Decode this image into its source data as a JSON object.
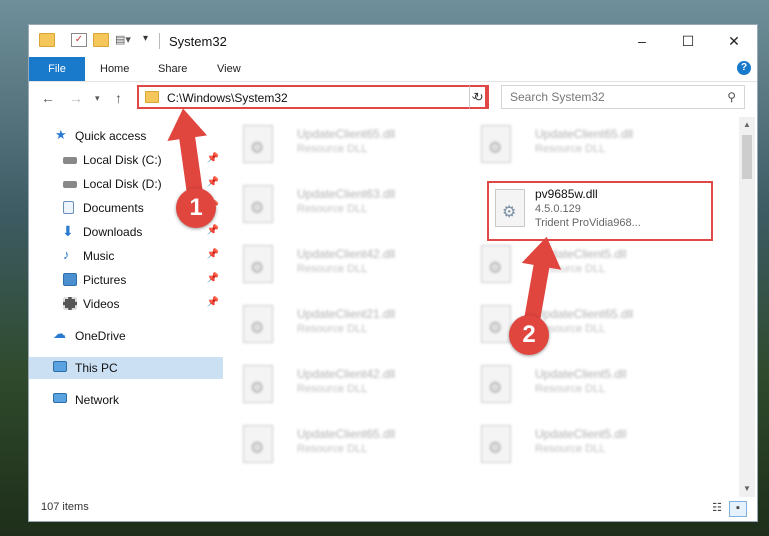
{
  "window": {
    "title": "System32",
    "controls": {
      "minimize": "–",
      "maximize": "☐",
      "close": "✕"
    }
  },
  "ribbon": {
    "tabs": [
      "File",
      "Home",
      "Share",
      "View"
    ],
    "help": "?"
  },
  "nav": {
    "address": "C:\\Windows\\System32",
    "search_placeholder": "Search System32"
  },
  "sidebar": {
    "items": [
      {
        "label": "Quick access",
        "icon": "star-icon",
        "color": "#2b79d0",
        "pinned": false
      },
      {
        "label": "Local Disk (C:)",
        "icon": "drive-icon",
        "color": "#777777",
        "pinned": true
      },
      {
        "label": "Local Disk (D:)",
        "icon": "drive-icon",
        "color": "#777777",
        "pinned": true
      },
      {
        "label": "Documents",
        "icon": "document-icon",
        "color": "#6a8fb8",
        "pinned": true
      },
      {
        "label": "Downloads",
        "icon": "download-icon",
        "color": "#2b79d0",
        "pinned": true
      },
      {
        "label": "Music",
        "icon": "music-icon",
        "color": "#2b79d0",
        "pinned": true
      },
      {
        "label": "Pictures",
        "icon": "pictures-icon",
        "color": "#4a8fd0",
        "pinned": true
      },
      {
        "label": "Videos",
        "icon": "video-icon",
        "color": "#555555",
        "pinned": true
      },
      {
        "label": "OneDrive",
        "icon": "cloud-icon",
        "color": "#2b79d0",
        "pinned": false
      },
      {
        "label": "This PC",
        "icon": "computer-icon",
        "color": "#2b79d0",
        "pinned": false
      },
      {
        "label": "Network",
        "icon": "network-icon",
        "color": "#2b79d0",
        "pinned": false
      }
    ]
  },
  "files": [
    {
      "name": "UpdateClient65.dll",
      "desc": "Resource DLL"
    },
    {
      "name": "UpdateClient65.dll",
      "desc": "Resource DLL"
    },
    {
      "name": "UpdateClient63.dll",
      "desc": "Resource DLL"
    },
    {
      "name": "pv9685w.dll",
      "version": "4.5.0.129",
      "desc": "Trident ProVidia968..."
    },
    {
      "name": "UpdateClient42.dll",
      "desc": "Resource DLL"
    },
    {
      "name": "UpdateClient5.dll",
      "desc": "Resource DLL"
    },
    {
      "name": "UpdateClient21.dll",
      "desc": "Resource DLL"
    },
    {
      "name": "UpdateClient65.dll",
      "desc": "Resource DLL"
    },
    {
      "name": "UpdateClient42.dll",
      "desc": "Resource DLL"
    },
    {
      "name": "UpdateClient5.dll",
      "desc": "Resource DLL"
    },
    {
      "name": "UpdateClient65.dll",
      "desc": "Resource DLL"
    },
    {
      "name": "UpdateClient5.dll",
      "desc": "Resource DLL"
    }
  ],
  "status": {
    "count": "107 items"
  },
  "annotations": {
    "step1": "1",
    "step2": "2"
  },
  "colors": {
    "accent": "#1979ca",
    "highlight": "#e04848"
  }
}
